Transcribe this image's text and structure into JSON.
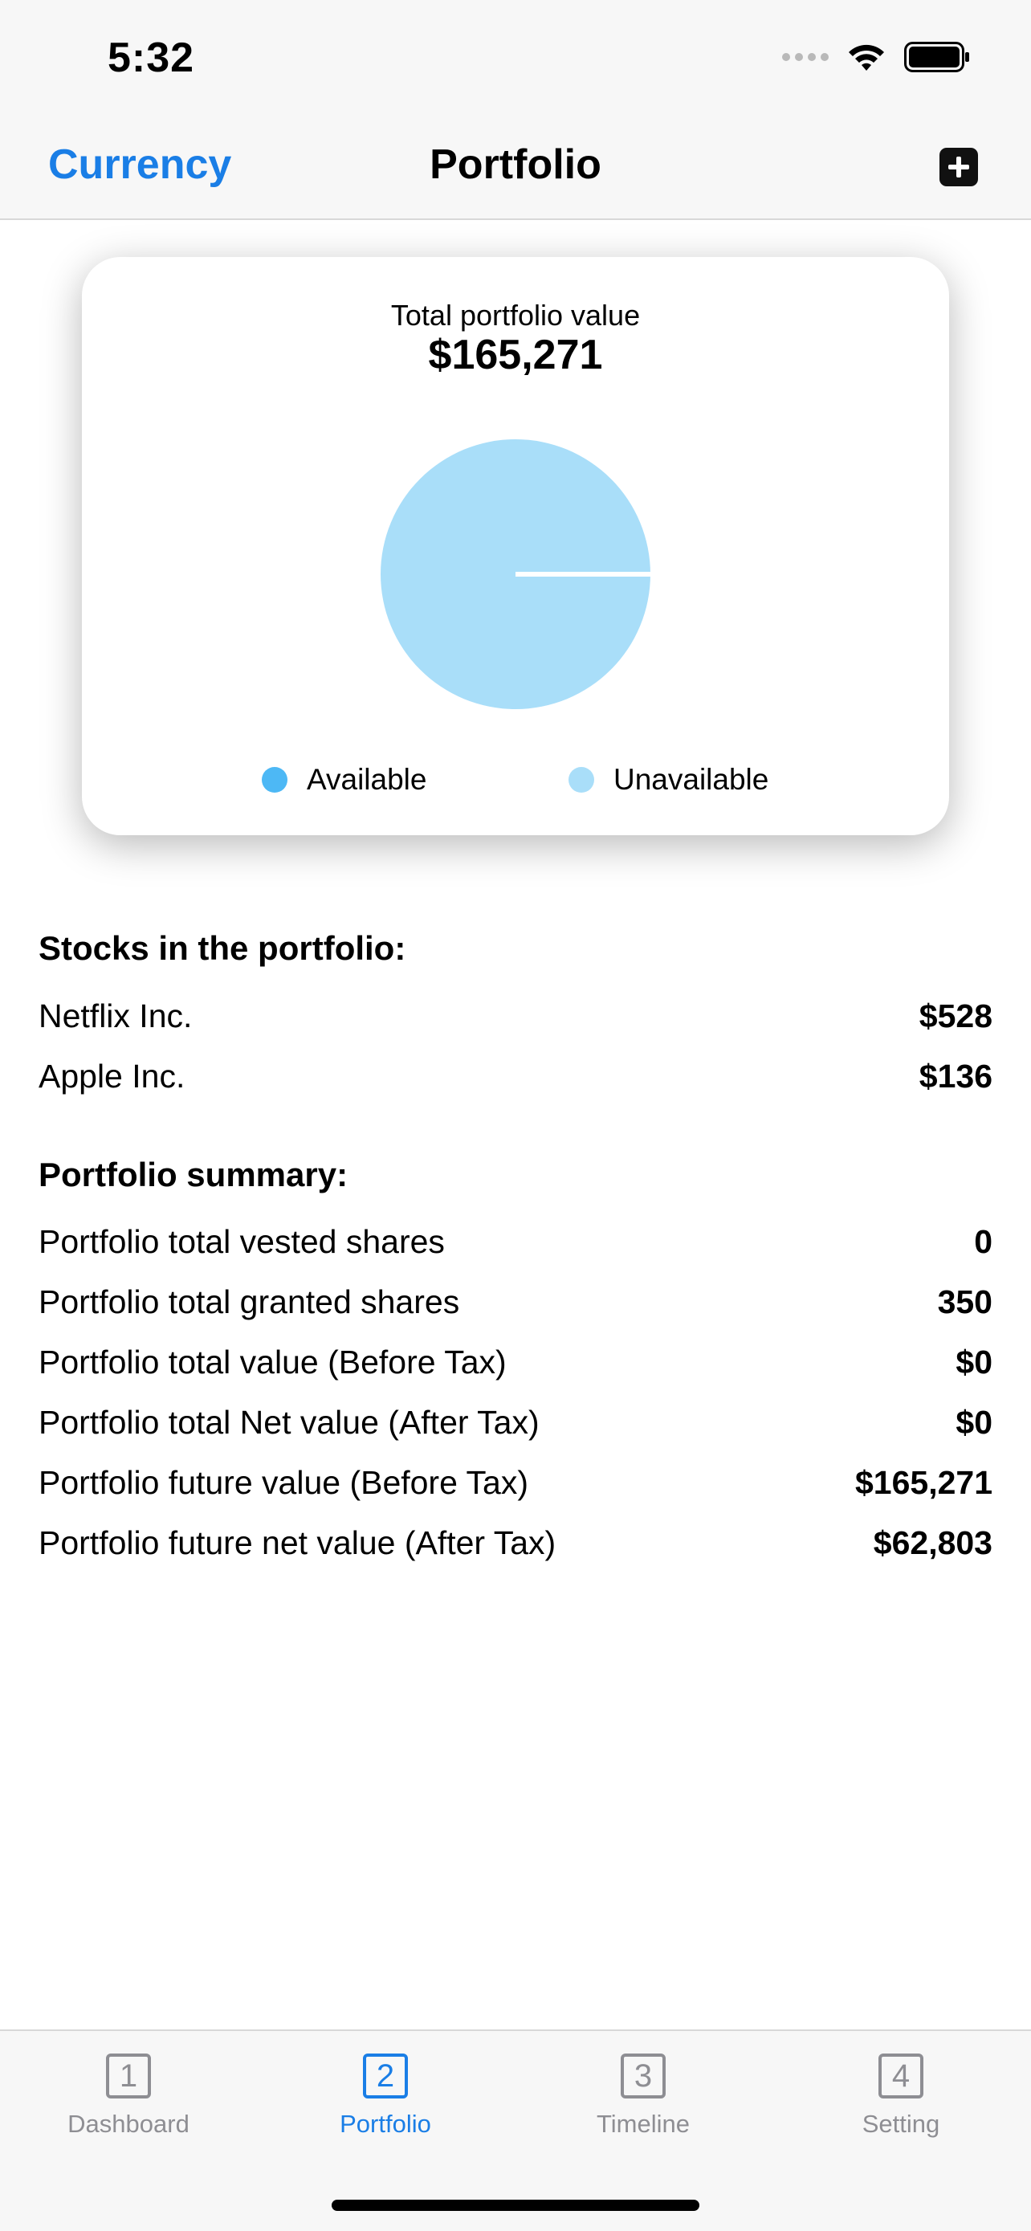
{
  "status_bar": {
    "time": "5:32"
  },
  "nav": {
    "left_button": "Currency",
    "title": "Portfolio",
    "add_icon": "plus-square-icon"
  },
  "card": {
    "label": "Total portfolio value",
    "value": "$165,271",
    "legend": [
      {
        "label": "Available",
        "color": "#4db8f5"
      },
      {
        "label": "Unavailable",
        "color": "#a9def9"
      }
    ]
  },
  "chart_data": {
    "type": "pie",
    "title": "",
    "series": [
      {
        "name": "Available",
        "value": 0,
        "color": "#4db8f5"
      },
      {
        "name": "Unavailable",
        "value": 165271,
        "color": "#a9def9"
      }
    ]
  },
  "stocks": {
    "title": "Stocks in the portfolio:",
    "items": [
      {
        "label": "Netflix Inc.",
        "value": "$528"
      },
      {
        "label": "Apple Inc.",
        "value": "$136"
      }
    ]
  },
  "summary": {
    "title": "Portfolio summary:",
    "items": [
      {
        "label": "Portfolio total vested shares",
        "value": "0"
      },
      {
        "label": "Portfolio total granted shares",
        "value": "350"
      },
      {
        "label": "Portfolio total value (Before Tax)",
        "value": "$0"
      },
      {
        "label": "Portfolio total Net value (After Tax)",
        "value": "$0"
      },
      {
        "label": "Portfolio future value (Before Tax)",
        "value": "$165,271"
      },
      {
        "label": "Portfolio future net value (After Tax)",
        "value": "$62,803"
      }
    ]
  },
  "tabs": [
    {
      "number": "1",
      "label": "Dashboard"
    },
    {
      "number": "2",
      "label": "Portfolio"
    },
    {
      "number": "3",
      "label": "Timeline"
    },
    {
      "number": "4",
      "label": "Setting"
    }
  ],
  "colors": {
    "accent": "#1a7ee6",
    "inactive": "#8e8e93"
  }
}
